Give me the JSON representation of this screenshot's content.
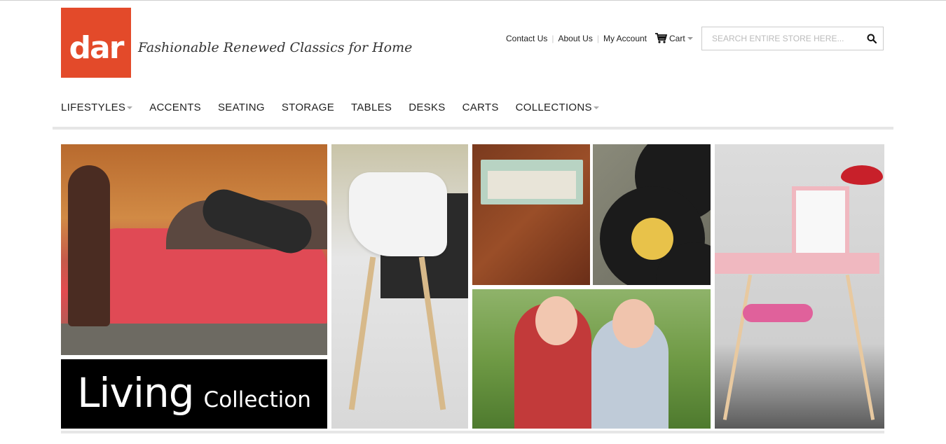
{
  "brand": {
    "logo_text": "dar",
    "trademark": "®",
    "tagline": "Fashionable Renewed Classics for Home",
    "color": "#e34a2a"
  },
  "toplinks": {
    "contact": "Contact Us",
    "about": "About Us",
    "account": "My Account",
    "cart": "Cart"
  },
  "search": {
    "placeholder": "SEARCH ENTIRE STORE HERE..."
  },
  "nav": {
    "items": [
      {
        "label": "LIFESTYLES",
        "has_dropdown": true
      },
      {
        "label": "ACCENTS",
        "has_dropdown": false
      },
      {
        "label": "SEATING",
        "has_dropdown": false
      },
      {
        "label": "STORAGE",
        "has_dropdown": false
      },
      {
        "label": "TABLES",
        "has_dropdown": false
      },
      {
        "label": "DESKS",
        "has_dropdown": false
      },
      {
        "label": "CARTS",
        "has_dropdown": false
      },
      {
        "label": "COLLECTIONS",
        "has_dropdown": true
      }
    ]
  },
  "hero": {
    "banner_big": "Living",
    "banner_small": "Collection"
  }
}
